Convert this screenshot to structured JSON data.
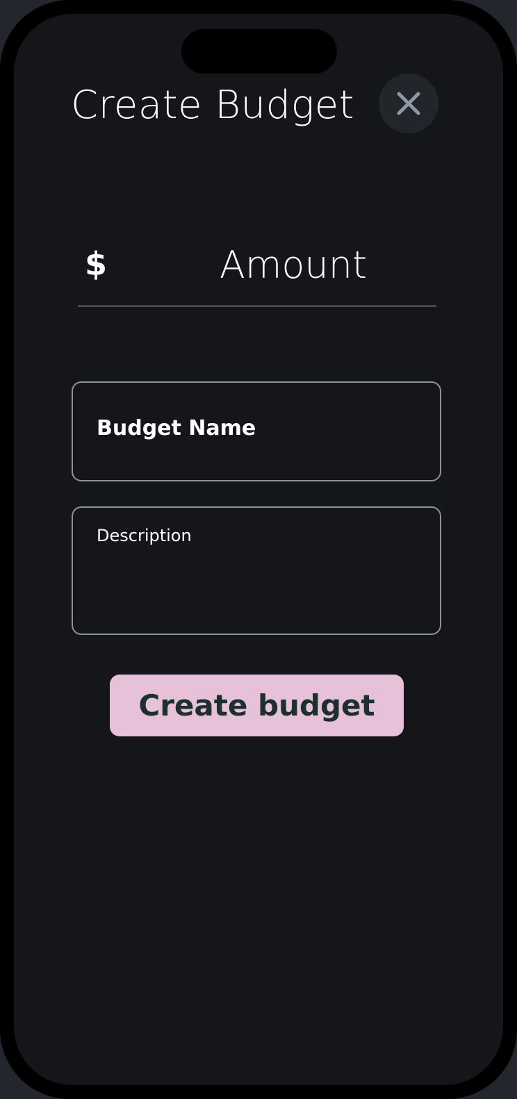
{
  "colors": {
    "page_background": "#23272d",
    "phone_frame": "#000000",
    "screen_background": "#15161a",
    "text_primary": "#ffffff",
    "field_border": "#8d939a",
    "divider": "#d9dadc",
    "close_button_background": "#22252a",
    "close_icon": "#8e99a6",
    "primary_button_background": "#e7c1da",
    "primary_button_text": "#1d302d"
  },
  "header": {
    "title": "Create Budget",
    "close_icon": "close-icon"
  },
  "amount": {
    "currency_symbol": "$",
    "placeholder": "Amount"
  },
  "form": {
    "budget_name_label": "Budget Name",
    "description_label": "Description"
  },
  "actions": {
    "create_label": "Create budget"
  }
}
